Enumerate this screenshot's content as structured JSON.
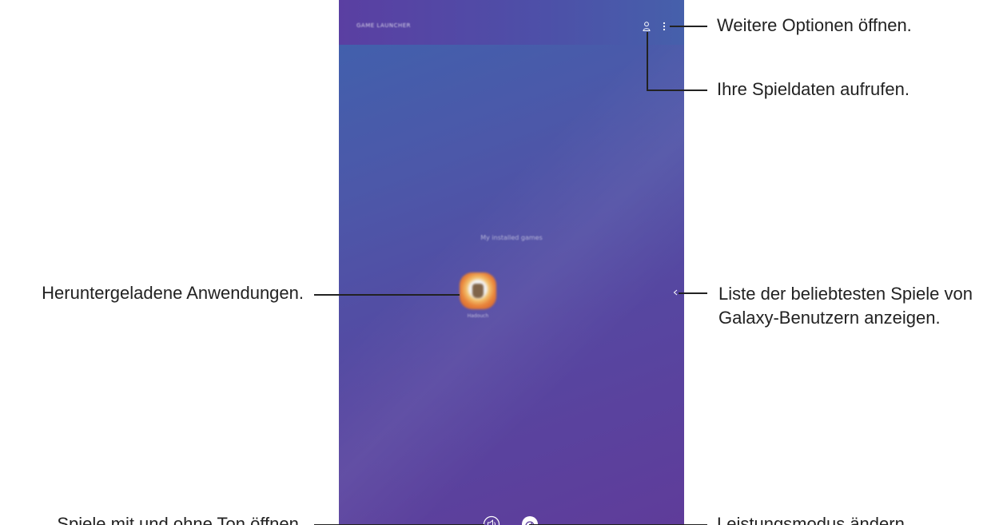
{
  "app": {
    "title": "GAME LAUNCHER",
    "section_label": "My installed games",
    "installed_games": [
      {
        "name": "Hadouch"
      }
    ]
  },
  "icons": {
    "profile": "profile-icon",
    "more_options": "more-options-icon",
    "popular_games_chevron": "chevron-left-icon",
    "sound_mode": "sound-toggle-icon",
    "performance_mode": "performance-mode-icon"
  },
  "callouts": {
    "options": "Weitere Optionen öffnen.",
    "play_data": "Ihre Spieldaten aufrufen.",
    "popular_games": [
      "Liste der beliebtesten Spiele von",
      "Galaxy-Benutzern anzeigen."
    ],
    "downloaded_apps": "Heruntergeladene Anwendungen.",
    "sound": "Spiele mit und ohne Ton öffnen.",
    "performance": "Leistungsmodus ändern."
  },
  "colors": {
    "screen_top": "#3f62ad",
    "screen_bottom": "#5f3c9a",
    "leader_line": "#222222",
    "text": "#222222"
  }
}
